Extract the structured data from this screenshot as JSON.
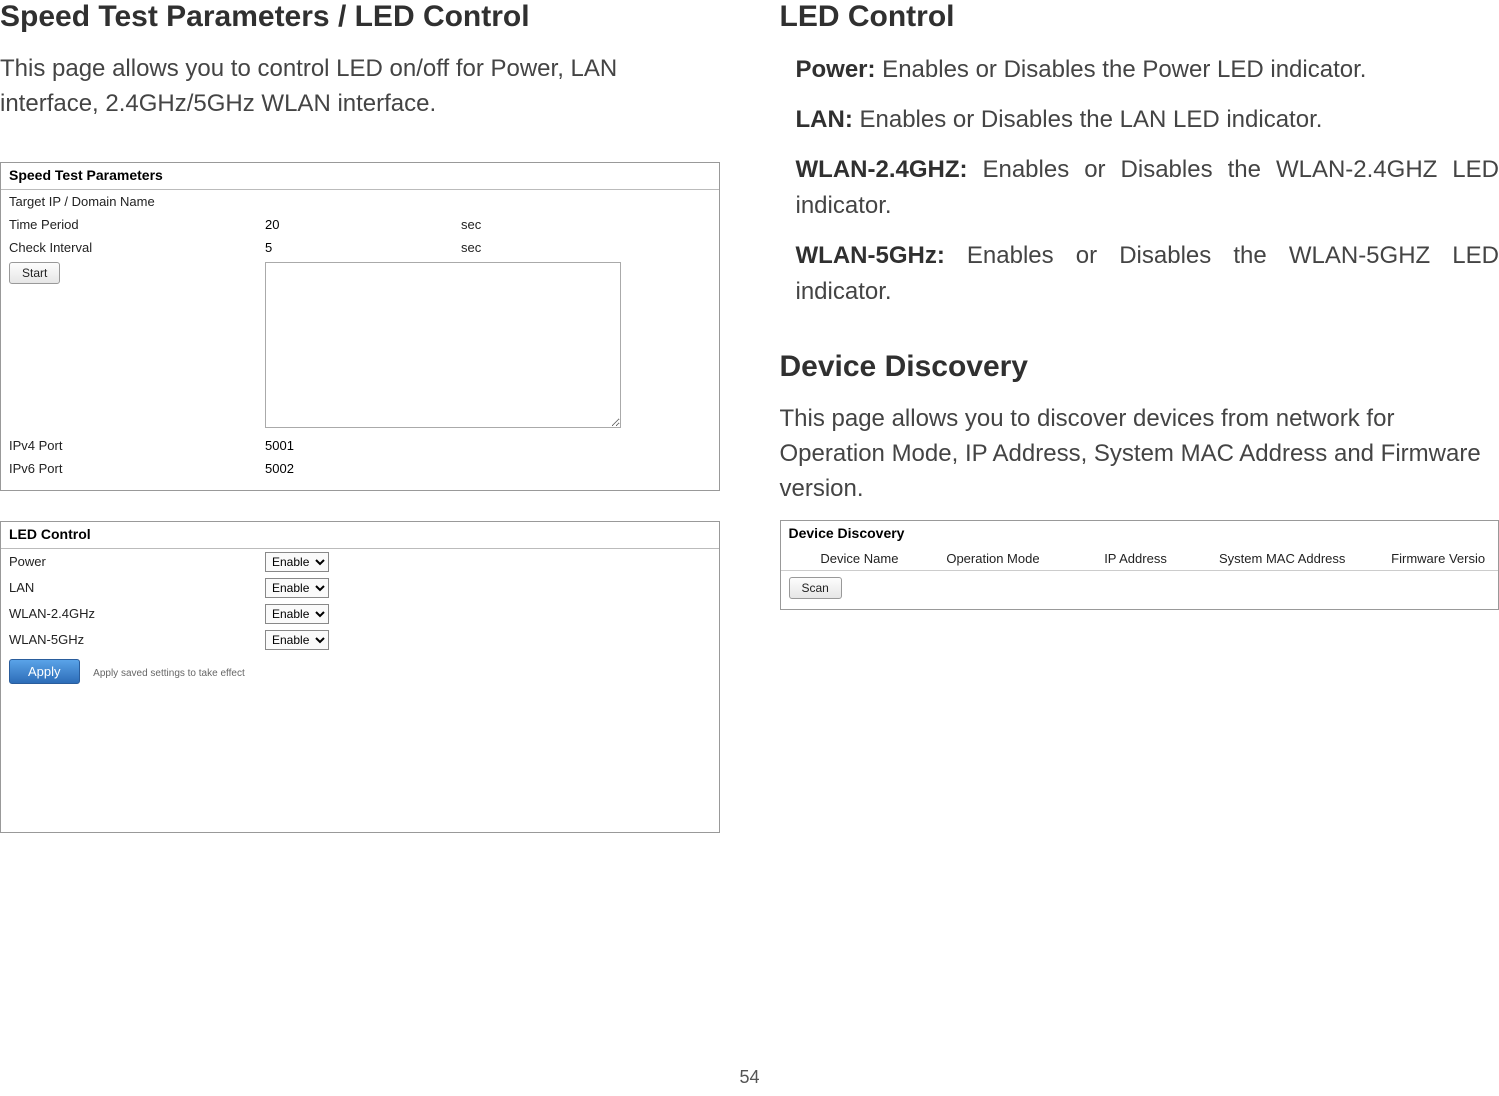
{
  "left": {
    "heading": "Speed Test Parameters / LED Control",
    "intro": "This page allows you to control LED on/off for Power, LAN interface, 2.4GHz/5GHz WLAN interface.",
    "speedTest": {
      "title": "Speed Test Parameters",
      "rows": {
        "target": {
          "label": "Target IP / Domain Name",
          "value": ""
        },
        "timePeriod": {
          "label": "Time Period",
          "value": "20",
          "unit": "sec"
        },
        "checkInterval": {
          "label": "Check Interval",
          "value": "5",
          "unit": "sec"
        },
        "ipv4": {
          "label": "IPv4 Port",
          "value": "5001"
        },
        "ipv6": {
          "label": "IPv6 Port",
          "value": "5002"
        }
      },
      "startBtn": "Start"
    },
    "ledControl": {
      "title": "LED Control",
      "rows": {
        "power": {
          "label": "Power",
          "value": "Enable"
        },
        "lan": {
          "label": "LAN",
          "value": "Enable"
        },
        "wlan24": {
          "label": "WLAN-2.4GHz",
          "value": "Enable"
        },
        "wlan5": {
          "label": "WLAN-5GHz",
          "value": "Enable"
        }
      },
      "applyBtn": "Apply",
      "applyHint": "Apply saved settings to take effect"
    }
  },
  "right": {
    "heading": "LED Control",
    "items": {
      "power": {
        "label": "Power:",
        "text": " Enables or Disables the Power LED indicator."
      },
      "lan": {
        "label": "LAN:",
        "text": " Enables or Disables the LAN LED indicator."
      },
      "wlan24": {
        "label": "WLAN-2.4GHZ:",
        "text": " Enables or Disables the WLAN-2.4GHZ LED indicator."
      },
      "wlan5": {
        "label": "WLAN-5GHz:",
        "text": " Enables or Disables the WLAN-5GHZ LED indicator."
      }
    },
    "ddHeading": "Device Discovery",
    "ddIntro": "This page allows you to discover devices from network for Operation Mode, IP Address, System MAC Address and Firmware version.",
    "ddPanel": {
      "title": "Device Discovery",
      "cols": {
        "name": "Device Name",
        "op": "Operation Mode",
        "ip": "IP Address",
        "mac": "System MAC Address",
        "fw": "Firmware Versio"
      },
      "scanBtn": "Scan"
    }
  },
  "pageNumber": "54"
}
